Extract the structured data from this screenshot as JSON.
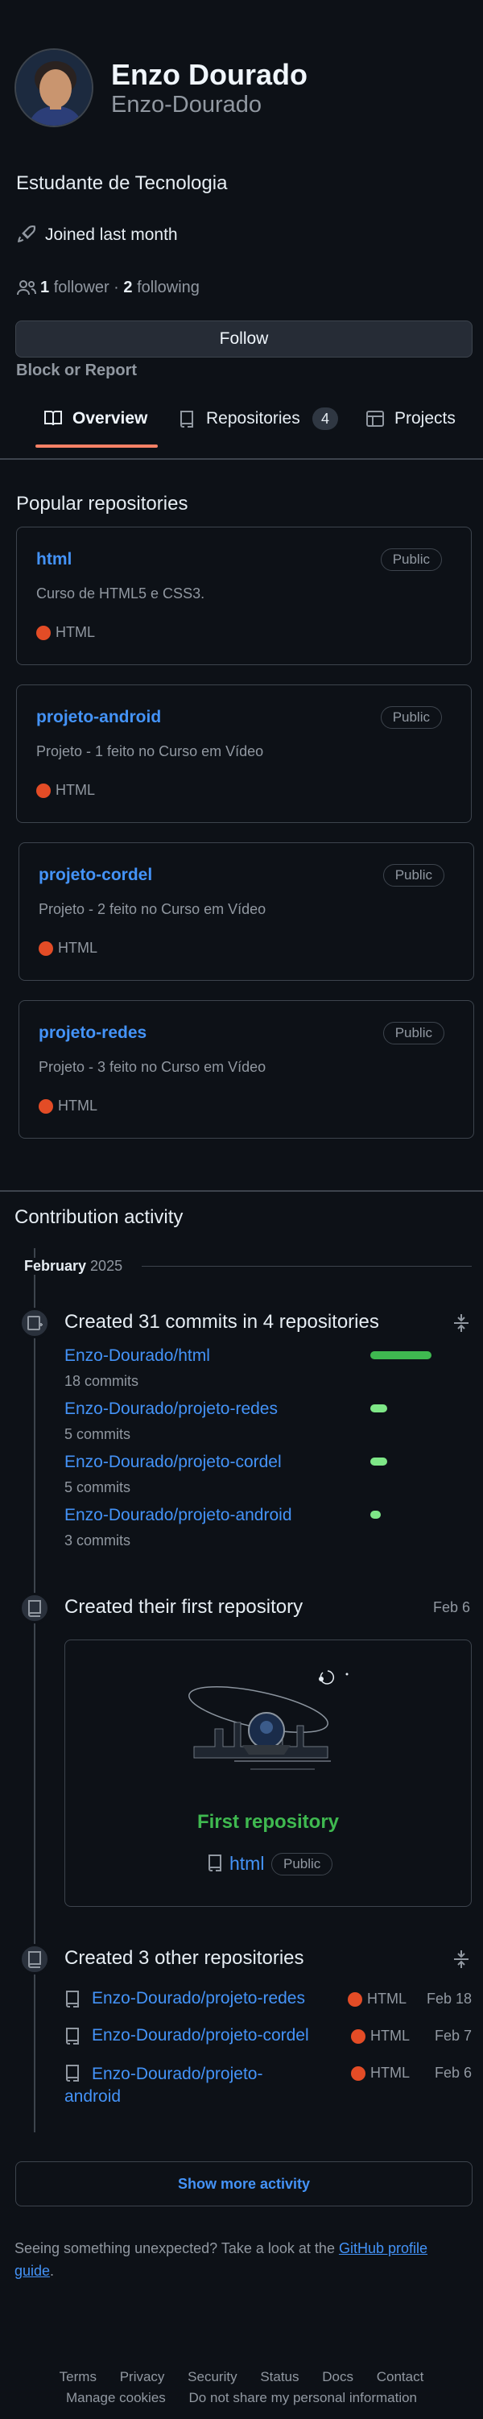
{
  "profile": {
    "name": "Enzo Dourado",
    "username": "Enzo-Dourado",
    "bio": "Estudante de Tecnologia",
    "joined": "Joined last month",
    "followers_count": "1",
    "followers_label": "follower",
    "sep": "·",
    "following_count": "2",
    "following_label": "following",
    "follow_button": "Follow",
    "block_report": "Block or Report"
  },
  "tabs": [
    {
      "label": "Overview",
      "icon": "book-icon",
      "selected": true
    },
    {
      "label": "Repositories",
      "icon": "repo-icon",
      "count": "4"
    },
    {
      "label": "Projects",
      "icon": "table-icon"
    }
  ],
  "popular": {
    "heading": "Popular repositories",
    "repos": [
      {
        "name": "html",
        "visibility": "Public",
        "description": "Curso de HTML5 e CSS3.",
        "language": "HTML"
      },
      {
        "name": "projeto-android",
        "visibility": "Public",
        "description": "Projeto - 1 feito no Curso em Vídeo",
        "language": "HTML"
      },
      {
        "name": "projeto-cordel",
        "visibility": "Public",
        "description": "Projeto - 2 feito no Curso em Vídeo",
        "language": "HTML"
      },
      {
        "name": "projeto-redes",
        "visibility": "Public",
        "description": "Projeto - 3 feito no Curso em Vídeo",
        "language": "HTML"
      }
    ],
    "language_color": "#e34c26"
  },
  "activity": {
    "heading": "Contribution activity",
    "month": "February",
    "year": "2025",
    "commits": {
      "title": "Created 31 commits in 4 repositories",
      "rows": [
        {
          "repo": "Enzo-Dourado/html",
          "count": "18 commits",
          "level": 18
        },
        {
          "repo": "Enzo-Dourado/projeto-redes",
          "count": "5 commits",
          "level": 5
        },
        {
          "repo": "Enzo-Dourado/projeto-cordel",
          "count": "5 commits",
          "level": 5
        },
        {
          "repo": "Enzo-Dourado/projeto-android",
          "count": "3 commits",
          "level": 3
        }
      ]
    },
    "first_repo": {
      "title": "Created their first repository",
      "date": "Feb 6",
      "label": "First repository",
      "repo": "html",
      "visibility": "Public"
    },
    "other_repos": {
      "title": "Created 3 other repositories",
      "rows": [
        {
          "repo": "Enzo-Dourado/projeto-redes",
          "language": "HTML",
          "date": "Feb 18"
        },
        {
          "repo": "Enzo-Dourado/projeto-cordel",
          "language": "HTML",
          "date": "Feb 7"
        },
        {
          "repo_line1": "Enzo-Dourado/projeto-",
          "repo_line2": "android",
          "language": "HTML",
          "date": "Feb 6"
        }
      ]
    },
    "show_more": "Show more activity",
    "unexpected_text": "Seeing something unexpected? Take a look at the ",
    "guide_link_line1": "GitHub profile",
    "guide_link_line2": "guide",
    "period": "."
  },
  "footer": {
    "links": [
      "Terms",
      "Privacy",
      "Security",
      "Status",
      "Docs",
      "Contact"
    ],
    "manage_cookies": "Manage cookies",
    "do_not_share": "Do not share my personal information"
  },
  "colors": {
    "accent": "#4493f8",
    "green": "#3fb950",
    "tab_underline": "#f78166"
  }
}
